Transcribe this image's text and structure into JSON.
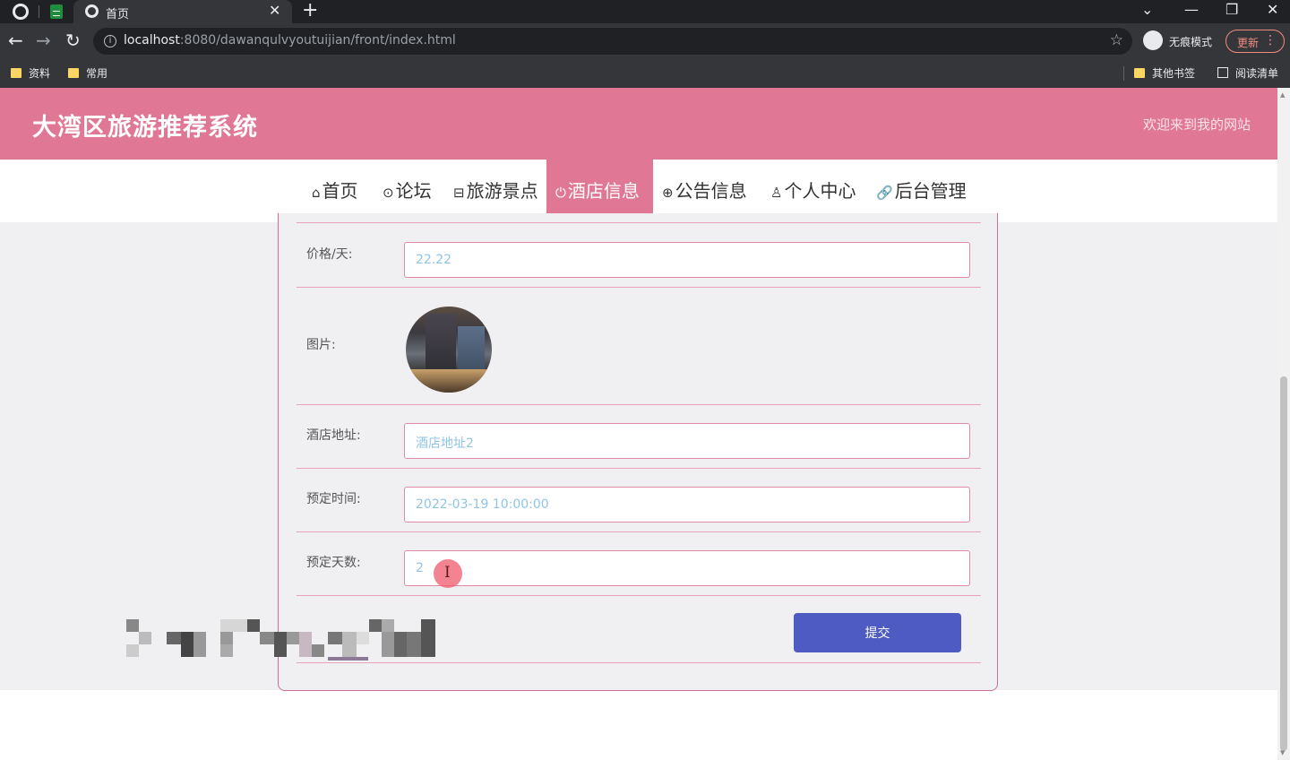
{
  "browser": {
    "tab_title": "首页",
    "url_host": "localhost",
    "url_rest": ":8080/dawanqulvyoutuijian/front/index.html",
    "incognito_label": "无痕模式",
    "update_label": "更新",
    "bookmarks": [
      "资料",
      "常用"
    ],
    "bookmarks_right": [
      "其他书签",
      "阅读清单"
    ]
  },
  "site": {
    "title": "大湾区旅游推荐系统",
    "welcome": "欢迎来到我的网站"
  },
  "nav": [
    {
      "icon": "⌂",
      "label": "首页"
    },
    {
      "icon": "⊙",
      "label": "论坛"
    },
    {
      "icon": "⊟",
      "label": "旅游景点"
    },
    {
      "icon": "⏻",
      "label": "酒店信息"
    },
    {
      "icon": "⊕",
      "label": "公告信息"
    },
    {
      "icon": "♙",
      "label": "个人中心"
    },
    {
      "icon": "🔗",
      "label": "后台管理"
    }
  ],
  "form": {
    "price": {
      "label": "价格/天:",
      "value": "22.22"
    },
    "image": {
      "label": "图片:"
    },
    "address": {
      "label": "酒店地址:",
      "value": "酒店地址2"
    },
    "time": {
      "label": "预定时间:",
      "value": "2022-03-19 10:00:00"
    },
    "days": {
      "label": "预定天数:",
      "value": "2"
    },
    "submit_label": "提交"
  },
  "colors": {
    "brand_pink": "#e07795",
    "submit_blue": "#4e5bc2"
  }
}
